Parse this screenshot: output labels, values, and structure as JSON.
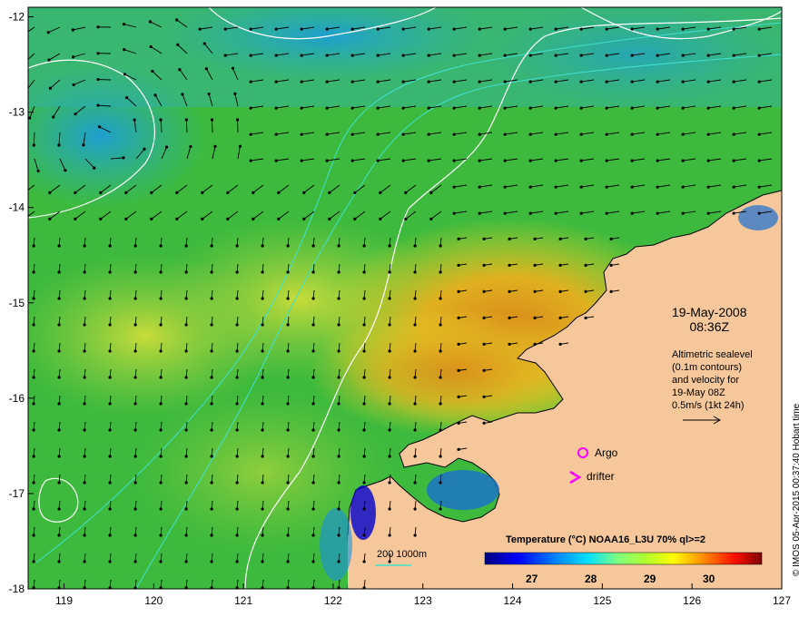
{
  "map": {
    "lon_ticks": [
      "119",
      "120",
      "121",
      "122",
      "123",
      "124",
      "125",
      "126",
      "127"
    ],
    "lat_ticks": [
      "-12",
      "-13",
      "-14",
      "-15",
      "-16",
      "-17",
      "-18"
    ],
    "lon_range": [
      118.6,
      127
    ],
    "lat_range": [
      -18,
      -11.9
    ]
  },
  "annotation": {
    "date": "19-May-2008",
    "time": "08:36Z",
    "info_lines": [
      "Altimetric sealevel",
      "(0.1m contours)",
      "and velocity for",
      "19-May 08Z",
      "0.5m/s (1kt 24h)"
    ]
  },
  "legend": {
    "argo": "Argo",
    "drifter": "drifter",
    "argo_color": "#ff00ff",
    "drifter_color": "#ff00ff",
    "bathy_scale": "200  1000m",
    "bathy_color": "#40e0d0"
  },
  "colorbar": {
    "title": "Temperature (°C) NOAA16_L3U 70% ql>=2",
    "ticks": [
      "27",
      "28",
      "29",
      "30"
    ],
    "range": [
      26.5,
      30.9
    ],
    "colors": [
      "#00007f",
      "#0000ff",
      "#007fff",
      "#00ffff",
      "#7fff7f",
      "#33cc33",
      "#ffff00",
      "#ff7f00",
      "#ff0000",
      "#7f0000"
    ]
  },
  "credit": "© IMOS 05-Apr-2015 00:37:40 Hobart time",
  "colors": {
    "land": "#f5c79b",
    "sea_green": "#3dba3d",
    "sea_warm": "#d69a1f",
    "sea_cool": "#2fa8c8",
    "contour": "#ffffff",
    "arrow": "#000000"
  }
}
